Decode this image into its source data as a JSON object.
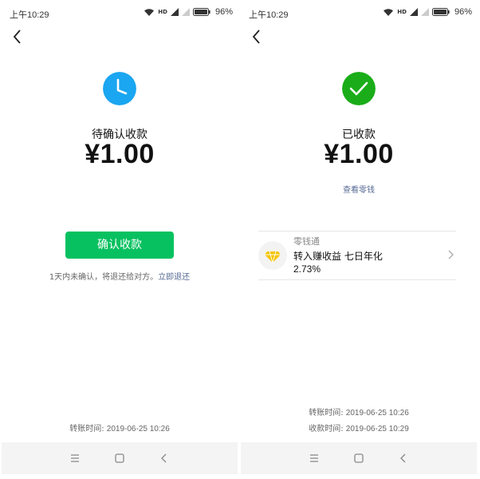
{
  "left": {
    "status_bar": {
      "time": "上午10:29",
      "network": "HD",
      "battery": "96%"
    },
    "status_text": "待确认收款",
    "amount": "¥1.00",
    "confirm_button": "确认收款",
    "refund_note": "1天内未确认，将退还给对方。",
    "refund_link": "立即退还",
    "transfer_time_label": "转账时间:",
    "transfer_time_value": "2019-06-25 10:26"
  },
  "right": {
    "status_bar": {
      "time": "上午10:29",
      "network": "HD",
      "battery": "96%"
    },
    "status_text": "已收款",
    "amount": "¥1.00",
    "view_change_link": "查看零钱",
    "lingqiantong": {
      "title": "零钱通",
      "line1": "转入赚收益 七日年化",
      "line2": "2.73%"
    },
    "transfer_time_label": "转账时间:",
    "transfer_time_value": "2019-06-25 10:26",
    "receive_time_label": "收款时间:",
    "receive_time_value": "2019-06-25 10:29"
  },
  "colors": {
    "wechat_green": "#07c160",
    "clock_blue": "#1aa6f0",
    "success_green": "#1aad19",
    "link_blue": "#576b95",
    "diamond_gold": "#f5c400"
  },
  "icons": {
    "pending": "clock-icon",
    "received": "checkmark-circle-icon",
    "lingqiantong": "diamond-icon",
    "back": "back-arrow-icon",
    "nav": [
      "menu-icon",
      "home-square-icon",
      "back-triangle-icon"
    ]
  }
}
